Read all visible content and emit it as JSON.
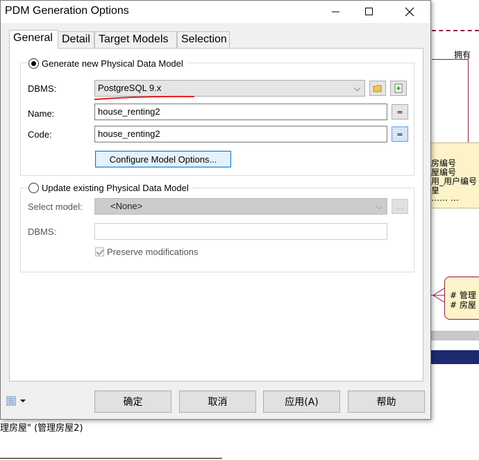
{
  "background": {
    "relation_label": "拥有",
    "entity_1_rows": [
      "房编号",
      "屋编号",
      "用_用户编号",
      "皇",
      "…… …"
    ],
    "entity_2_rows": [
      "#  管理",
      "#  房屋"
    ],
    "bottom_label": "理房屋\" (管理房屋2)"
  },
  "dialog": {
    "title": "PDM Generation Options",
    "tabs": [
      {
        "label": "General",
        "active": true
      },
      {
        "label": "Detail",
        "active": false
      },
      {
        "label": "Target Models",
        "active": false
      },
      {
        "label": "Selection",
        "active": false
      }
    ],
    "general": {
      "generate_new_label": "Generate new Physical Data Model",
      "generate_new_checked": true,
      "dbms_label": "DBMS:",
      "dbms_value": "PostgreSQL 9.x",
      "name_label": "Name:",
      "name_value": "house_renting2",
      "code_label": "Code:",
      "code_value": "house_renting2",
      "equals_glyph": "=",
      "configure_label": "Configure Model Options...",
      "update_existing_label": "Update existing Physical Data Model",
      "update_existing_checked": false,
      "select_model_label": "Select model:",
      "select_model_value": "<None>",
      "browse_label": "...",
      "dbms2_label": "DBMS:",
      "dbms2_value": "",
      "preserve_label": "Preserve modifications",
      "preserve_checked": true
    },
    "buttons": {
      "ok": "确定",
      "cancel": "取消",
      "apply": "应用(A)",
      "help": "帮助"
    }
  },
  "colors": {
    "highlight_blue": "#0078d7",
    "annotation_red": "#e02020",
    "relation_line": "#8b1a4a",
    "entity_fill": "#fdf3c9"
  }
}
